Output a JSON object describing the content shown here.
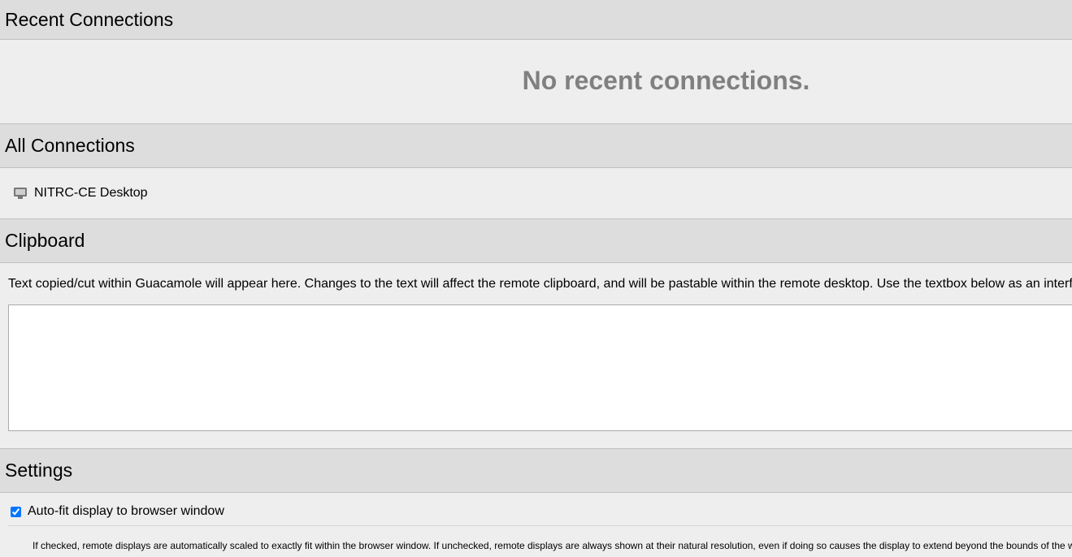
{
  "recent": {
    "title": "Recent Connections",
    "empty_message": "No recent connections."
  },
  "all": {
    "title": "All Connections",
    "connections": [
      {
        "label": "NITRC-CE Desktop",
        "icon": "monitor-icon"
      }
    ]
  },
  "clipboard": {
    "title": "Clipboard",
    "description": "Text copied/cut within Guacamole will appear here. Changes to the text will affect the remote clipboard, and will be pastable within the remote desktop. Use the textbox below as an interface b",
    "value": ""
  },
  "settings": {
    "title": "Settings",
    "autofit_label": "Auto-fit display to browser window",
    "autofit_checked": true,
    "autofit_help": "If checked, remote displays are automatically scaled to exactly fit within the browser window. If unchecked, remote displays are always shown at their natural resolution, even if doing so causes the display to extend beyond the bounds of the window"
  }
}
